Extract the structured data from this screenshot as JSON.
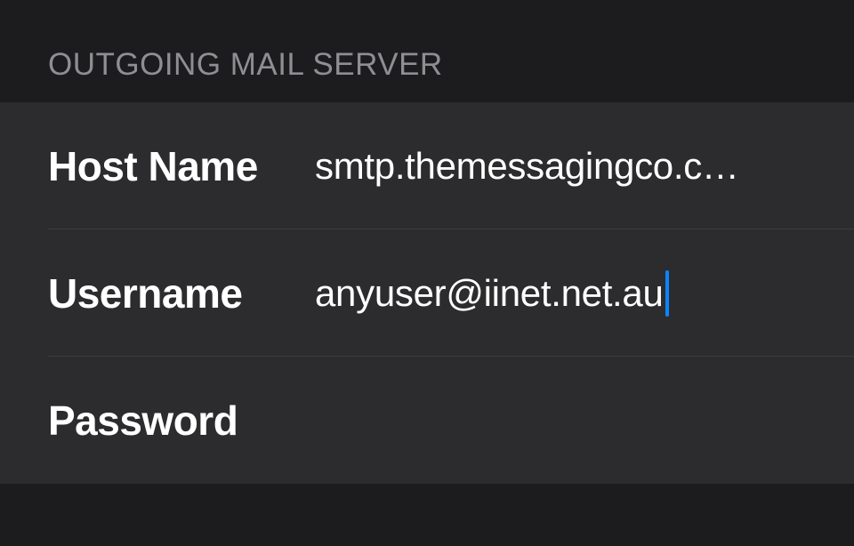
{
  "section": {
    "title": "Outgoing Mail Server",
    "rows": {
      "host": {
        "label": "Host Name",
        "value": "smtp.themessagingco.c…"
      },
      "username": {
        "label": "Username",
        "value": "anyuser@iinet.net.au"
      },
      "password": {
        "label": "Password",
        "value": ""
      }
    }
  }
}
